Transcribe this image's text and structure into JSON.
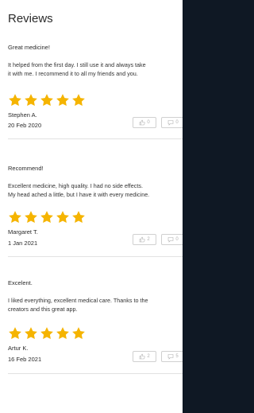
{
  "header": {
    "title": "Reviews"
  },
  "reviews": [
    {
      "title": "Great medicine!",
      "body": [
        "It helped from the first day. I still use it and always take",
        "it with me. I recommend it to all my friends and you."
      ],
      "rating": 5,
      "author": "Stephen A.",
      "date": "20 Feb 2020",
      "likes": "0",
      "comments": "0"
    },
    {
      "title": "Recommend!",
      "body": [
        "Excellent medicine, high quality. I had no side effects.",
        "My head ached a little, but I have it with every medicine."
      ],
      "rating": 5,
      "author": "Margaret T.",
      "date": "1 Jan 2021",
      "likes": "2",
      "comments": "0"
    },
    {
      "title": "Excelent.",
      "body": [
        "I liked everything, excellent medical care. Thanks to the",
        "creators and this great app."
      ],
      "rating": 5,
      "author": "Artur K.",
      "date": "16 Feb 2021",
      "likes": "2",
      "comments": "5"
    }
  ],
  "colors": {
    "star": "#f5b400",
    "background": "#ffffff",
    "side": "#0f1824"
  },
  "icons": {
    "like": "thumbs-up-icon",
    "comment": "comment-bubble-icon",
    "star": "star-icon"
  }
}
